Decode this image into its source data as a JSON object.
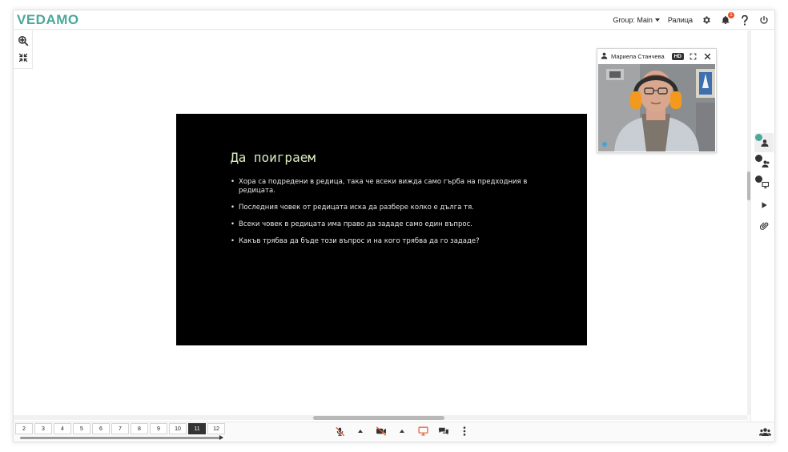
{
  "app": {
    "logo": "VEDAMO",
    "logo_color": "#4aa89a"
  },
  "header": {
    "group_label": "Group: Main",
    "room_name": "Ралица",
    "notification_count": "1",
    "notification_badge_color": "#e8542f"
  },
  "slide": {
    "title": "Да поиграем",
    "title_color": "#d9ecc0",
    "text_color": "#e8e8e8",
    "bullets": [
      "Хора са подредени в редица, така че всеки вижда само гърба на предходния в редицата.",
      "Последния човек от редицата иска да разбере колко е дълга тя.",
      "Всеки човек в редицата има право да зададе само един въпрос.",
      "Какъв трябва да бъде този въпрос и на кого трябва да го зададе?"
    ]
  },
  "video": {
    "participant_name": "Мариела Станчева",
    "quality_badge": "HD",
    "headset_color": "#f39a1e"
  },
  "pages": {
    "labels": [
      "2",
      "3",
      "4",
      "5",
      "6",
      "7",
      "8",
      "9",
      "10",
      "11",
      "12"
    ],
    "active": "11"
  },
  "icons": {
    "zoom": "zoom-in-icon",
    "fit": "collapse-icon",
    "settings": "gear-icon",
    "notifications": "bell-icon",
    "help": "question-icon",
    "power": "power-icon",
    "mic": "microphone-muted-icon",
    "camera": "camera-muted-icon",
    "screen": "screen-share-icon",
    "chat": "chat-icon",
    "more": "more-vertical-icon",
    "users": "users-icon"
  }
}
